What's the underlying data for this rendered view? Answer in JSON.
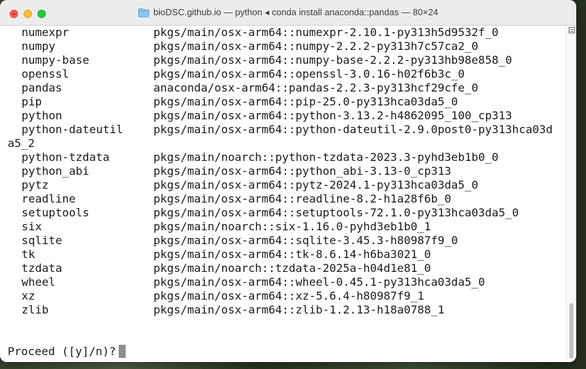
{
  "window": {
    "title": "bioDSC.github.io — python ◂ conda install anaconda::pandas — 80×24"
  },
  "terminal": {
    "rows": [
      {
        "name": "numexpr",
        "spec": "pkgs/main/osx-arm64::numexpr-2.10.1-py313h5d9532f_0"
      },
      {
        "name": "numpy",
        "spec": "pkgs/main/osx-arm64::numpy-2.2.2-py313h7c57ca2_0"
      },
      {
        "name": "numpy-base",
        "spec": "pkgs/main/osx-arm64::numpy-base-2.2.2-py313hb98e858_0"
      },
      {
        "name": "openssl",
        "spec": "pkgs/main/osx-arm64::openssl-3.0.16-h02f6b3c_0"
      },
      {
        "name": "pandas",
        "spec": "anaconda/osx-arm64::pandas-2.2.3-py313hcf29cfe_0"
      },
      {
        "name": "pip",
        "spec": "pkgs/main/osx-arm64::pip-25.0-py313hca03da5_0"
      },
      {
        "name": "python",
        "spec": "pkgs/main/osx-arm64::python-3.13.2-h4862095_100_cp313"
      },
      {
        "name": "python-dateutil",
        "spec": "pkgs/main/osx-arm64::python-dateutil-2.9.0post0-py313hca03d"
      },
      {
        "name": "",
        "spec": "",
        "wrap": "a5_2"
      },
      {
        "name": "python-tzdata",
        "spec": "pkgs/main/noarch::python-tzdata-2023.3-pyhd3eb1b0_0"
      },
      {
        "name": "python_abi",
        "spec": "pkgs/main/osx-arm64::python_abi-3.13-0_cp313"
      },
      {
        "name": "pytz",
        "spec": "pkgs/main/osx-arm64::pytz-2024.1-py313hca03da5_0"
      },
      {
        "name": "readline",
        "spec": "pkgs/main/osx-arm64::readline-8.2-h1a28f6b_0"
      },
      {
        "name": "setuptools",
        "spec": "pkgs/main/osx-arm64::setuptools-72.1.0-py313hca03da5_0"
      },
      {
        "name": "six",
        "spec": "pkgs/main/noarch::six-1.16.0-pyhd3eb1b0_1"
      },
      {
        "name": "sqlite",
        "spec": "pkgs/main/osx-arm64::sqlite-3.45.3-h80987f9_0"
      },
      {
        "name": "tk",
        "spec": "pkgs/main/osx-arm64::tk-8.6.14-h6ba3021_0"
      },
      {
        "name": "tzdata",
        "spec": "pkgs/main/noarch::tzdata-2025a-h04d1e81_0"
      },
      {
        "name": "wheel",
        "spec": "pkgs/main/osx-arm64::wheel-0.45.1-py313hca03da5_0"
      },
      {
        "name": "xz",
        "spec": "pkgs/main/osx-arm64::xz-5.6.4-h80987f9_1"
      },
      {
        "name": "zlib",
        "spec": "pkgs/main/osx-arm64::zlib-1.2.13-h18a0788_1"
      }
    ],
    "prompt": "Proceed ([y]/n)?"
  },
  "icons": {
    "close": "close-button",
    "minimize": "minimize-button",
    "maximize": "maximize-button",
    "folder": "folder-icon",
    "menu": "scrollbar-menu-icon"
  },
  "colors": {
    "close": "#ff5f57",
    "minimize": "#febc2e",
    "maximize": "#28c840",
    "folder": "#6fb3e8"
  }
}
